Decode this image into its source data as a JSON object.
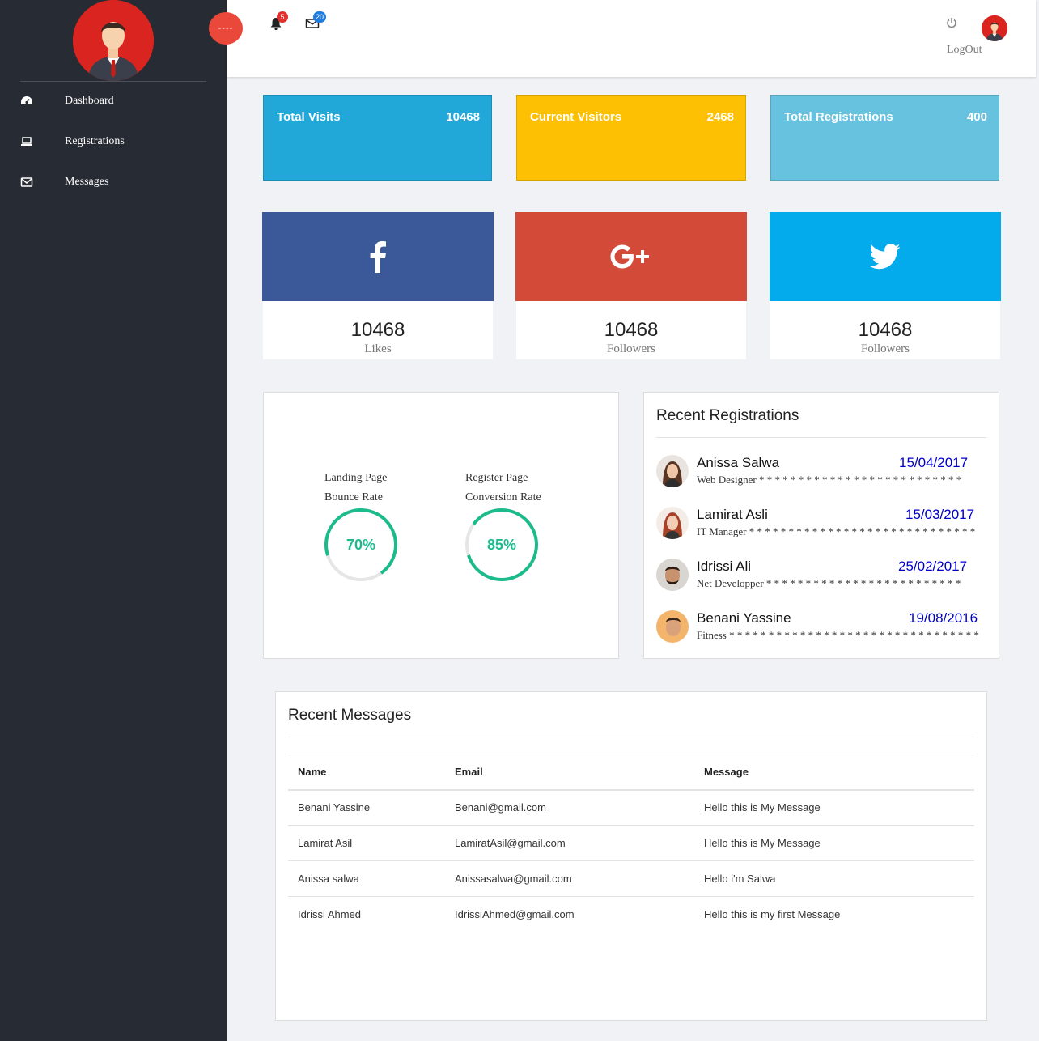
{
  "sidebar": {
    "items": [
      {
        "label": "Dashboard",
        "icon": "dashboard-icon"
      },
      {
        "label": "Registrations",
        "icon": "laptop-icon"
      },
      {
        "label": "Messages",
        "icon": "envelope-icon"
      }
    ]
  },
  "topbar": {
    "toggle_label": "----",
    "notifications_count": "5",
    "messages_count": "20",
    "logout_label": "LogOut"
  },
  "stats": [
    {
      "title": "Total Visits",
      "value": "10468",
      "color": "#22a7d9"
    },
    {
      "title": "Current Visitors",
      "value": "2468",
      "color": "#fdc002"
    },
    {
      "title": "Total Registrations",
      "value": "400",
      "color": "#67c2df"
    }
  ],
  "social": [
    {
      "network": "facebook",
      "icon": "facebook-icon",
      "value": "10468",
      "caption": "Likes",
      "color": "#3b5998"
    },
    {
      "network": "google-plus",
      "icon": "google-plus-icon",
      "value": "10468",
      "caption": "Followers",
      "color": "#d44a38"
    },
    {
      "network": "twitter",
      "icon": "twitter-icon",
      "value": "10468",
      "caption": "Followers",
      "color": "#03abec"
    }
  ],
  "rates": [
    {
      "line1": "Landing Page",
      "line2": "Bounce Rate",
      "value_text": "70%",
      "value": 70
    },
    {
      "line1": "Register Page",
      "line2": "Conversion Rate",
      "value_text": "85%",
      "value": 85
    }
  ],
  "recent_registrations": {
    "title": "Recent Registrations",
    "items": [
      {
        "name": "Anissa Salwa",
        "role": "Web Designer",
        "stars": "* * * * * * * * * * * * * * * * * * * * * * * * * *",
        "date": "15/04/2017"
      },
      {
        "name": "Lamirat Asli",
        "role": "IT Manager",
        "stars": "* * * * * * * * * * * * * * * * * * * * * * * * * * * * *",
        "date": "15/03/2017"
      },
      {
        "name": "Idrissi Ali",
        "role": "Net Developper",
        "stars": "* * * * * * * * * * * * * * * * * * * * * * * * *",
        "date": "25/02/2017"
      },
      {
        "name": "Benani Yassine",
        "role": "Fitness",
        "stars": "* * * * * * * * * * * * * * * * * * * * * * * * * * * * * * * *",
        "date": "19/08/2016"
      }
    ]
  },
  "recent_messages": {
    "title": "Recent Messages",
    "columns": [
      "Name",
      "Email",
      "Message"
    ],
    "rows": [
      [
        "Benani Yassine",
        "Benani@gmail.com",
        "Hello this is My Message"
      ],
      [
        "Lamirat Asil",
        "LamiratAsil@gmail.com",
        "Hello this is My Message"
      ],
      [
        "Anissa salwa",
        "Anissasalwa@gmail.com",
        "Hello i'm Salwa"
      ],
      [
        "Idrissi Ahmed",
        "IdrissiAhmed@gmail.com",
        "Hello this is my first Message"
      ]
    ]
  },
  "colors": {
    "sidebar_bg": "#272b33",
    "accent_red": "#e9483b",
    "gauge": "#1cbb8c",
    "date_blue": "#0000cc"
  }
}
